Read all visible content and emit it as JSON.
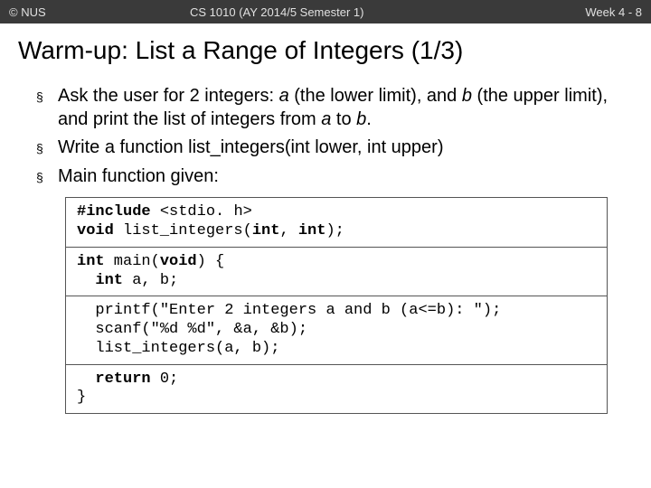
{
  "header": {
    "left": "© NUS",
    "center": "CS 1010 (AY 2014/5 Semester 1)",
    "right": "Week 4 - 8"
  },
  "title": "Warm-up: List a Range of Integers (1/3)",
  "bullets": {
    "b1_pre": "Ask the user for 2 integers: ",
    "b1_a": "a",
    "b1_mid1": " (the lower limit), and ",
    "b1_b": "b",
    "b1_mid2": " (the upper limit), and print the list of integers from ",
    "b1_a2": "a",
    "b1_to": " to ",
    "b1_b2": "b",
    "b1_end": ".",
    "b2": "Write a function list_integers(int lower, int upper)",
    "b3": "Main function given:"
  },
  "code": {
    "s1l1a": "#include ",
    "s1l1b": "<stdio. h>",
    "s1l2a": "void",
    "s1l2b": " list_integers(",
    "s1l2c": "int",
    "s1l2d": ", ",
    "s1l2e": "int",
    "s1l2f": ");",
    "s2l1a": "int",
    "s2l1b": " main(",
    "s2l1c": "void",
    "s2l1d": ") {",
    "s2l2a": "  ",
    "s2l2b": "int",
    "s2l2c": " a, b;",
    "s3l1": "  printf(\"Enter 2 integers a and b (a<=b): \");",
    "s3l2": "  scanf(\"%d %d\", &a, &b);",
    "s3l3": "  list_integers(a, b);",
    "s4l1a": "  ",
    "s4l1b": "return",
    "s4l1c": " 0;",
    "s4l2": "}"
  }
}
